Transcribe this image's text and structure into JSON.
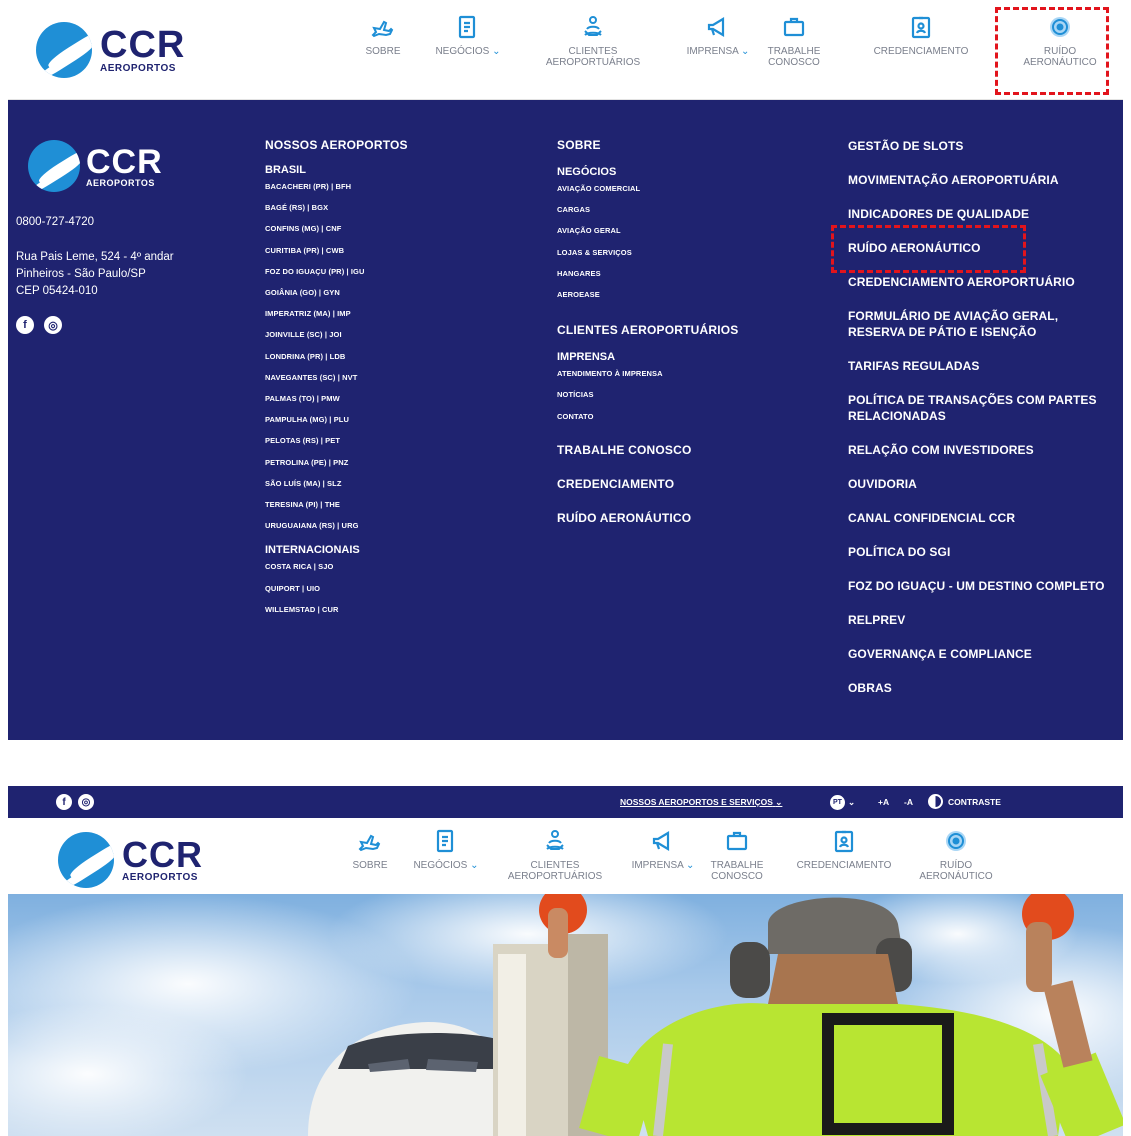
{
  "brand": {
    "name": "CCR",
    "sub": "AEROPORTOS"
  },
  "nav": {
    "sobre": "SOBRE",
    "negocios": "NEGÓCIOS",
    "clientes": "CLIENTES\nAEROPORTUÁRIOS",
    "imprensa": "IMPRENSA",
    "trabalhe": "TRABALHE\nCONOSCO",
    "credenciamento": "CREDENCIAMENTO",
    "ruido": "RUÍDO\nAERONÁUTICO",
    "chevron": "⌄"
  },
  "footer": {
    "phone": "0800-727-4720",
    "address1": "Rua Pais Leme, 524 - 4º andar",
    "address2": "Pinheiros - São Paulo/SP",
    "address3": "CEP 05424-010",
    "col1": {
      "heading": "NOSSOS AEROPORTOS",
      "brasil": "BRASIL",
      "airports": [
        "BACACHERI (PR) | BFH",
        "BAGÉ (RS) | BGX",
        "CONFINS (MG) | CNF",
        "CURITIBA (PR) | CWB",
        "FOZ DO IGUAÇU (PR) | IGU",
        "GOIÂNIA (GO) | GYN",
        "IMPERATRIZ (MA) | IMP",
        "JOINVILLE (SC) | JOI",
        "LONDRINA (PR) | LDB",
        "NAVEGANTES (SC) | NVT",
        "PALMAS (TO) | PMW",
        "PAMPULHA (MG) | PLU",
        "PELOTAS (RS) | PET",
        "PETROLINA (PE) | PNZ",
        "SÃO LUÍS (MA) | SLZ",
        "TERESINA (PI) | THE",
        "URUGUAIANA (RS) | URG"
      ],
      "internacionais": "INTERNACIONAIS",
      "intl": [
        "COSTA RICA | SJO",
        "QUIPORT | UIO",
        "WILLEMSTAD | CUR"
      ]
    },
    "col2": {
      "sobre": "SOBRE",
      "negocios": "NEGÓCIOS",
      "negocios_items": [
        "AVIAÇÃO COMERCIAL",
        "CARGAS",
        "AVIAÇÃO GERAL",
        "LOJAS & SERVIÇOS",
        "HANGARES",
        "AEROEASE"
      ],
      "clientes": "CLIENTES AEROPORTUÁRIOS",
      "imprensa": "IMPRENSA",
      "imprensa_items": [
        "ATENDIMENTO À IMPRENSA",
        "NOTÍCIAS",
        "CONTATO"
      ],
      "trabalhe": "TRABALHE CONOSCO",
      "credenciamento": "CREDENCIAMENTO",
      "ruido": "RUÍDO AERONÁUTICO"
    },
    "col3": [
      "GESTÃO DE SLOTS",
      "MOVIMENTAÇÃO AEROPORTUÁRIA",
      "INDICADORES DE QUALIDADE",
      "RUÍDO AERONÁUTICO",
      "CREDENCIAMENTO AEROPORTUÁRIO",
      "FORMULÁRIO DE AVIAÇÃO GERAL, RESERVA DE PÁTIO E ISENÇÃO",
      "TARIFAS REGULADAS",
      "POLÍTICA DE TRANSAÇÕES COM PARTES RELACIONADAS",
      "RELAÇÃO COM INVESTIDORES",
      "OUVIDORIA",
      "CANAL CONFIDENCIAL CCR",
      "POLÍTICA DO SGI",
      "FOZ DO IGUAÇU - UM DESTINO COMPLETO",
      "RELPREV",
      "GOVERNANÇA E COMPLIANCE",
      "OBRAS"
    ]
  },
  "topbar": {
    "services": "NOSSOS AEROPORTOS E SERVIÇOS",
    "lang": "PT",
    "font_plus": "+A",
    "font_minus": "-A",
    "contrast": "CONTRASTE"
  },
  "colors": {
    "navy": "#1f2370",
    "brand_blue": "#1f8fd6",
    "highlight_red": "#e2141c"
  }
}
